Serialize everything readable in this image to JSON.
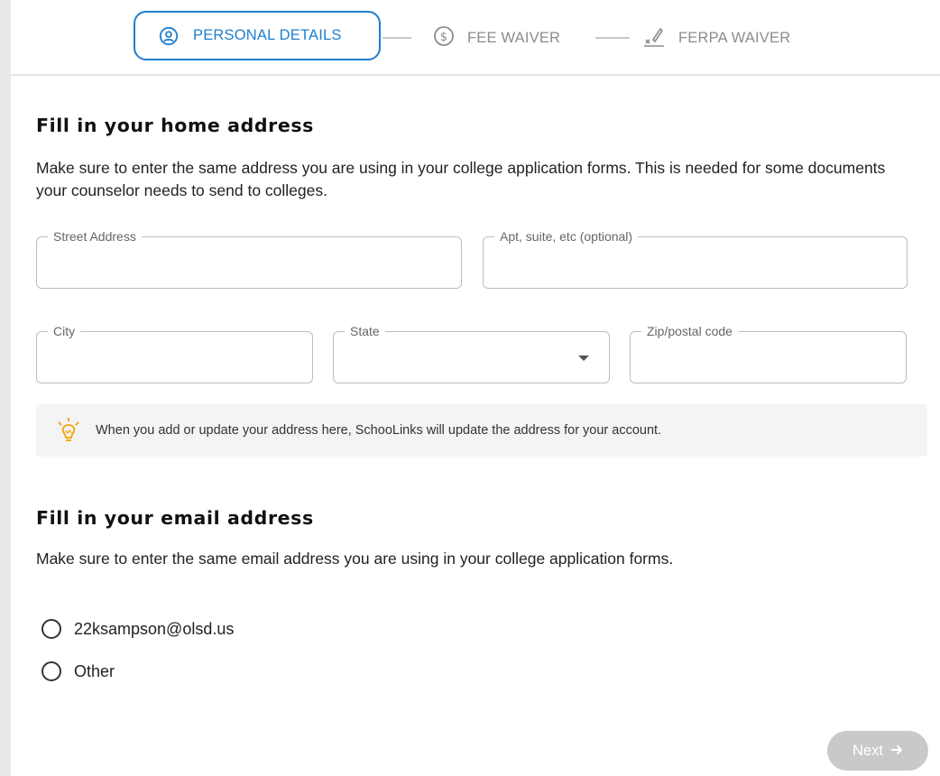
{
  "stepper": {
    "steps": [
      {
        "label": "PERSONAL DETAILS",
        "icon": "person-circle-icon",
        "state": "active"
      },
      {
        "label": "FEE WAIVER",
        "icon": "dollar-circle-icon",
        "state": "inactive"
      },
      {
        "label": "FERPA WAIVER",
        "icon": "signature-icon",
        "state": "inactive"
      }
    ]
  },
  "address_section": {
    "title": "Fill in your home address",
    "description": "Make sure to enter the same address you are using in your college application forms. This is needed for some documents your counselor needs to send to colleges.",
    "fields": {
      "street": {
        "label": "Street Address",
        "value": ""
      },
      "apt": {
        "label": "Apt, suite, etc (optional)",
        "value": ""
      },
      "city": {
        "label": "City",
        "value": ""
      },
      "state": {
        "label": "State",
        "value": ""
      },
      "zip": {
        "label": "Zip/postal code",
        "value": ""
      }
    },
    "note": {
      "icon": "lightbulb-icon",
      "text": "When you add or update your address here, SchooLinks will update the address for your account."
    }
  },
  "email_section": {
    "title": "Fill in your email address",
    "description": "Make sure to enter the same email address you are using in your college application forms.",
    "options": [
      {
        "label": "22ksampson@olsd.us",
        "selected": false
      },
      {
        "label": "Other",
        "selected": false
      }
    ]
  },
  "next_button": {
    "label": "Next",
    "icon": "arrow-right-icon",
    "disabled": true
  },
  "colors": {
    "accent": "#1f7fcf",
    "note_icon": "#f2a91d",
    "disabled_button": "#c9c9c9"
  }
}
